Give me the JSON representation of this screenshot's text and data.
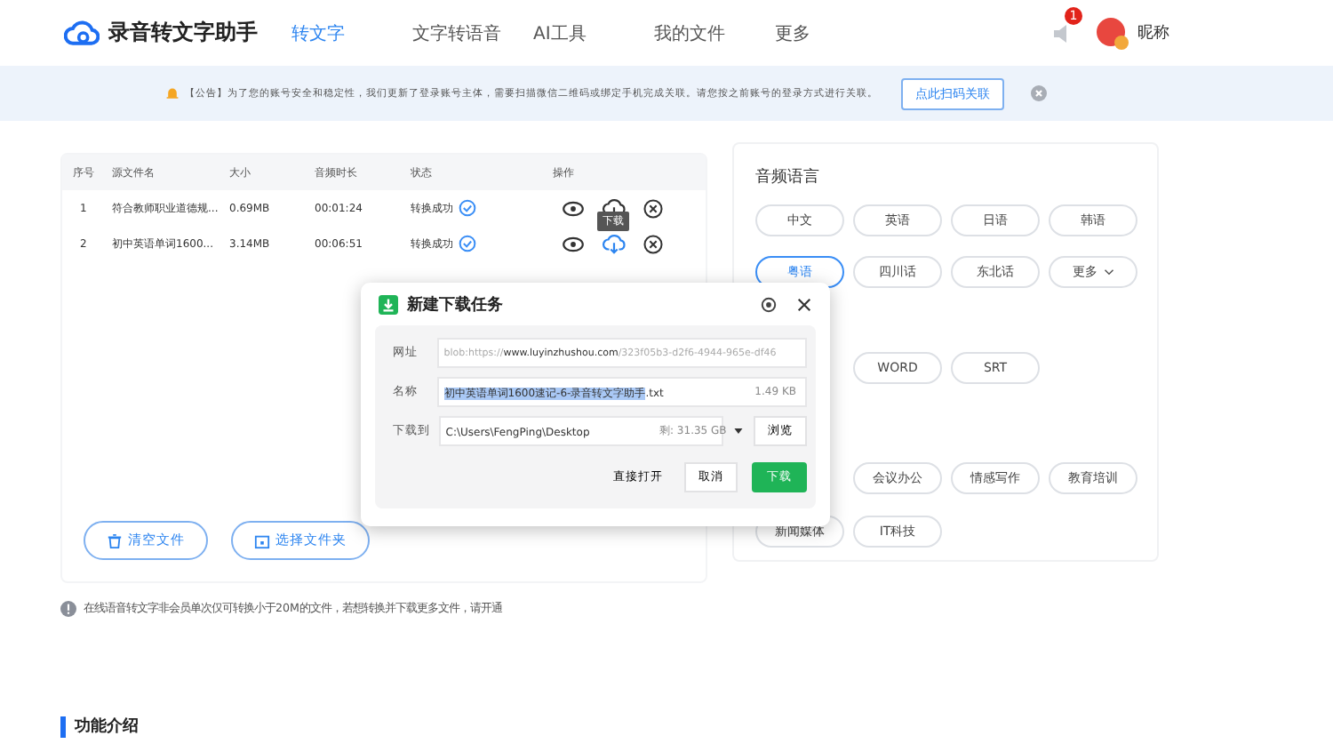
{
  "header": {
    "logo": "录音转文字助手",
    "nav": [
      {
        "label": "转文字",
        "selected": true
      },
      {
        "label": "文字转语音",
        "selected": false
      },
      {
        "label": "AI工具",
        "selected": false
      },
      {
        "label": "我的文件",
        "selected": false
      },
      {
        "label": "更多",
        "selected": false
      }
    ],
    "notification_count": "1",
    "user_name": "昵称"
  },
  "announcement": {
    "text": "【公告】为了您的账号安全和稳定性，我们更新了登录账号主体，需要扫描微信二维码或绑定手机完成关联。请您按之前账号的登录方式进行关联。",
    "button": "点此扫码关联"
  },
  "file_table": {
    "columns": [
      "序号",
      "源文件名",
      "大小",
      "音频时长",
      "状态",
      "操作"
    ],
    "rows": [
      {
        "index": "1",
        "name": "符合教师职业道德规...",
        "size": "0.69MB",
        "duration": "00:01:24",
        "status": "转换成功",
        "download_hovered": false
      },
      {
        "index": "2",
        "name": "初中英语单词1600...",
        "size": "3.14MB",
        "duration": "00:06:51",
        "status": "转换成功",
        "download_hovered": true
      }
    ],
    "tooltip": "下载",
    "buttons": [
      "清空文件",
      "选择文件夹"
    ]
  },
  "notice": "在线语音转文字非会员单次仅可转换小于20M的文件，若想转换并下载更多文件，请开通",
  "section_title": "功能介绍",
  "options": {
    "title": "音频语言",
    "languages": [
      {
        "label": "中文",
        "selected": false
      },
      {
        "label": "英语",
        "selected": false
      },
      {
        "label": "日语",
        "selected": false
      },
      {
        "label": "韩语",
        "selected": false
      },
      {
        "label": "粤语",
        "selected": true
      },
      {
        "label": "四川话",
        "selected": false
      },
      {
        "label": "东北话",
        "selected": false
      },
      {
        "label": "更多",
        "selected": false,
        "dropdown": true
      }
    ],
    "formats": [
      "WORD",
      "SRT"
    ],
    "domains": [
      "会议办公",
      "情感写作",
      "教育培训",
      "新闻媒体",
      "IT科技"
    ]
  },
  "dialog": {
    "title": "新建下载任务",
    "url_label": "网址",
    "url": "blob:https://**www.luyinzhushou.com**/323f05b3-d2f6-4944-965e-df46",
    "name_label": "名称",
    "name_selected": "初中英语单词1600速记-6-录音转文字助手",
    "name_rest": ".txt",
    "file_size": "1.49 KB",
    "path_label": "下载到",
    "path": "C:\\Users\\FengPing\\Desktop",
    "free_space": "剩: 31.35 GB",
    "browse": "浏览",
    "open_button": "直接打开",
    "cancel_button": "取消",
    "download_button": "下载"
  }
}
